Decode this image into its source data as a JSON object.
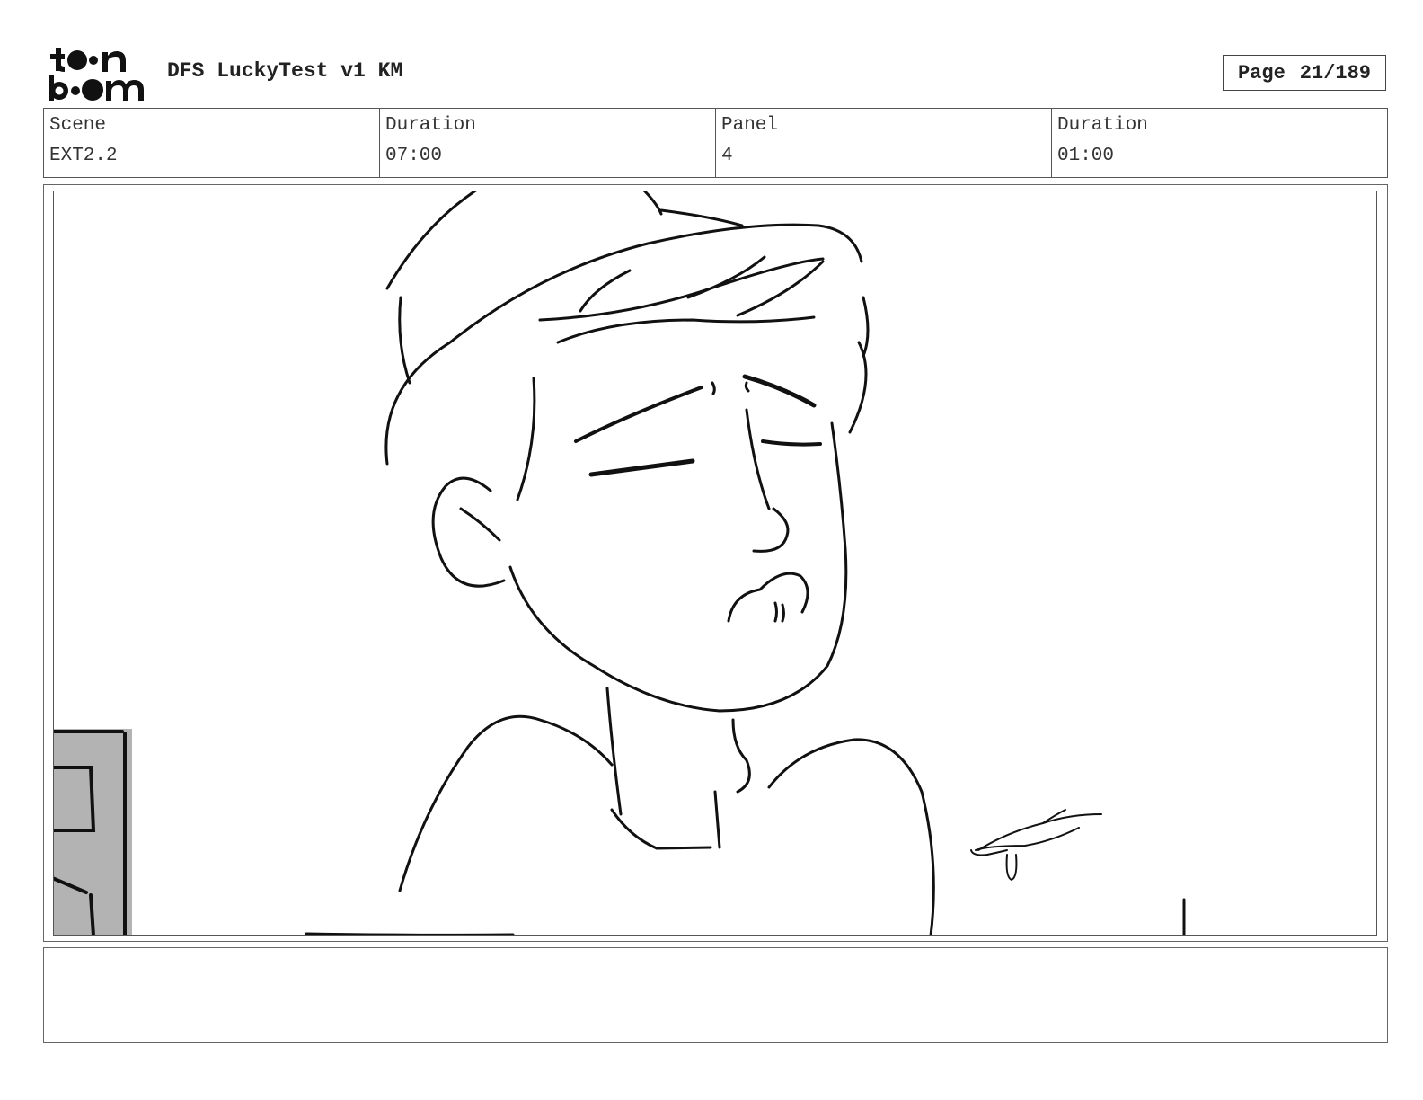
{
  "header": {
    "logo_name": "toon boom logo",
    "title": "DFS LuckyTest v1 KM"
  },
  "page": {
    "label": "Page",
    "number": "21/189"
  },
  "info": {
    "scene_label": "Scene",
    "scene_value": "EXT2.2",
    "scene_duration_label": "Duration",
    "scene_duration_value": "07:00",
    "panel_label": "Panel",
    "panel_value": "4",
    "panel_duration_label": "Duration",
    "panel_duration_value": "01:00"
  },
  "notes": {
    "text": ""
  }
}
